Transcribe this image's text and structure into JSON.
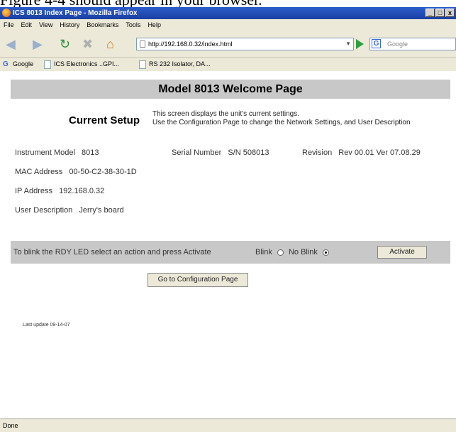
{
  "caption": "Figure 4-4 should appear in your browser.",
  "window": {
    "title": "ICS 8013 Index Page - Mozilla Firefox",
    "controls": [
      "_",
      "□",
      "x"
    ]
  },
  "menu": [
    "File",
    "Edit",
    "View",
    "History",
    "Bookmarks",
    "Tools",
    "Help"
  ],
  "nav": {
    "url": "http://192.168.0.32/index.html",
    "search_placeholder": "Google"
  },
  "bookmarks": [
    "Google",
    "ICS Electronics ..GPI...",
    "RS 232 Isolator, DA..."
  ],
  "page": {
    "heading": "Model 8013 Welcome Page",
    "setup_label": "Current Setup",
    "setup_desc_line1": "This screen displays the unit's current settings.",
    "setup_desc_line2": "Use the Configuration Page to change the Network Settings, and User Description",
    "instrument_model_label": "Instrument Model",
    "instrument_model_value": "8013",
    "serial_number_label": "Serial Number",
    "serial_number_value": "S/N 508013",
    "revision_label": "Revision",
    "revision_value": "Rev 00.01 Ver 07.08.29",
    "mac_label": "MAC Address",
    "mac_value": "00-50-C2-38-30-1D",
    "ip_label": "IP Address",
    "ip_value": "192.168.0.32",
    "user_desc_label": "User Description",
    "user_desc_value": "Jerry's board",
    "blink_prompt": "To blink the RDY LED select an action and press Activate",
    "blink_label": "Blink",
    "no_blink_label": "No Blink",
    "activate_label": "Activate",
    "config_button_label": "Go to Configuration Page",
    "last_update": "Last update 09-14-07"
  },
  "status": "Done"
}
